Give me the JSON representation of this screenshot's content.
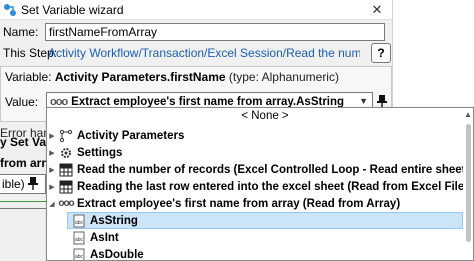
{
  "window": {
    "title": "Set Variable wizard",
    "close_glyph": "✕",
    "app_icon": "flow-icon"
  },
  "name_field": {
    "label": "Name:",
    "value": "firstNameFromArray"
  },
  "step": {
    "label": "This Step:",
    "link": "Activity Workflow/Transaction/Excel Session/Read the number of records/firstN...",
    "help_glyph": "?"
  },
  "variable": {
    "label": "Variable:",
    "name": "Activity Parameters.firstName",
    "type": "(type: Alphanumeric)"
  },
  "value": {
    "label": "Value:",
    "selected": "Extract employee's first name from array.AsString",
    "prefix_glyph": "ooo"
  },
  "background_fragments": {
    "f1": "Error handli",
    "f2": "y Set Varia",
    "f3": "from array",
    "f4": "ible)"
  },
  "dropdown": {
    "none_label": "< None >",
    "items": [
      {
        "label": "Activity Parameters",
        "icon": "parameters-icon",
        "expander": "▶"
      },
      {
        "label": "Settings",
        "icon": "settings-icon",
        "expander": "▶"
      },
      {
        "label": "Read the number of records (Excel Controlled Loop - Read entire sheet)",
        "icon": "grid-icon",
        "expander": "▶"
      },
      {
        "label": "Reading the last row entered into the excel sheet (Read from Excel File - Read mode Row)",
        "icon": "grid-icon",
        "expander": "▶"
      },
      {
        "label": "Extract employee's first name from array (Read from Array)",
        "icon": "array-icon",
        "expander": "◢"
      }
    ],
    "sub_items": [
      {
        "label": "AsString",
        "icon": "abc-icon"
      },
      {
        "label": "AsInt",
        "icon": "abc-icon"
      },
      {
        "label": "AsDouble",
        "icon": "abc-icon"
      }
    ],
    "selected_sub_index": 0
  },
  "colors": {
    "link": "#1a5fb4",
    "selection": "#cce4f7",
    "selection_border": "#99c9ef"
  }
}
